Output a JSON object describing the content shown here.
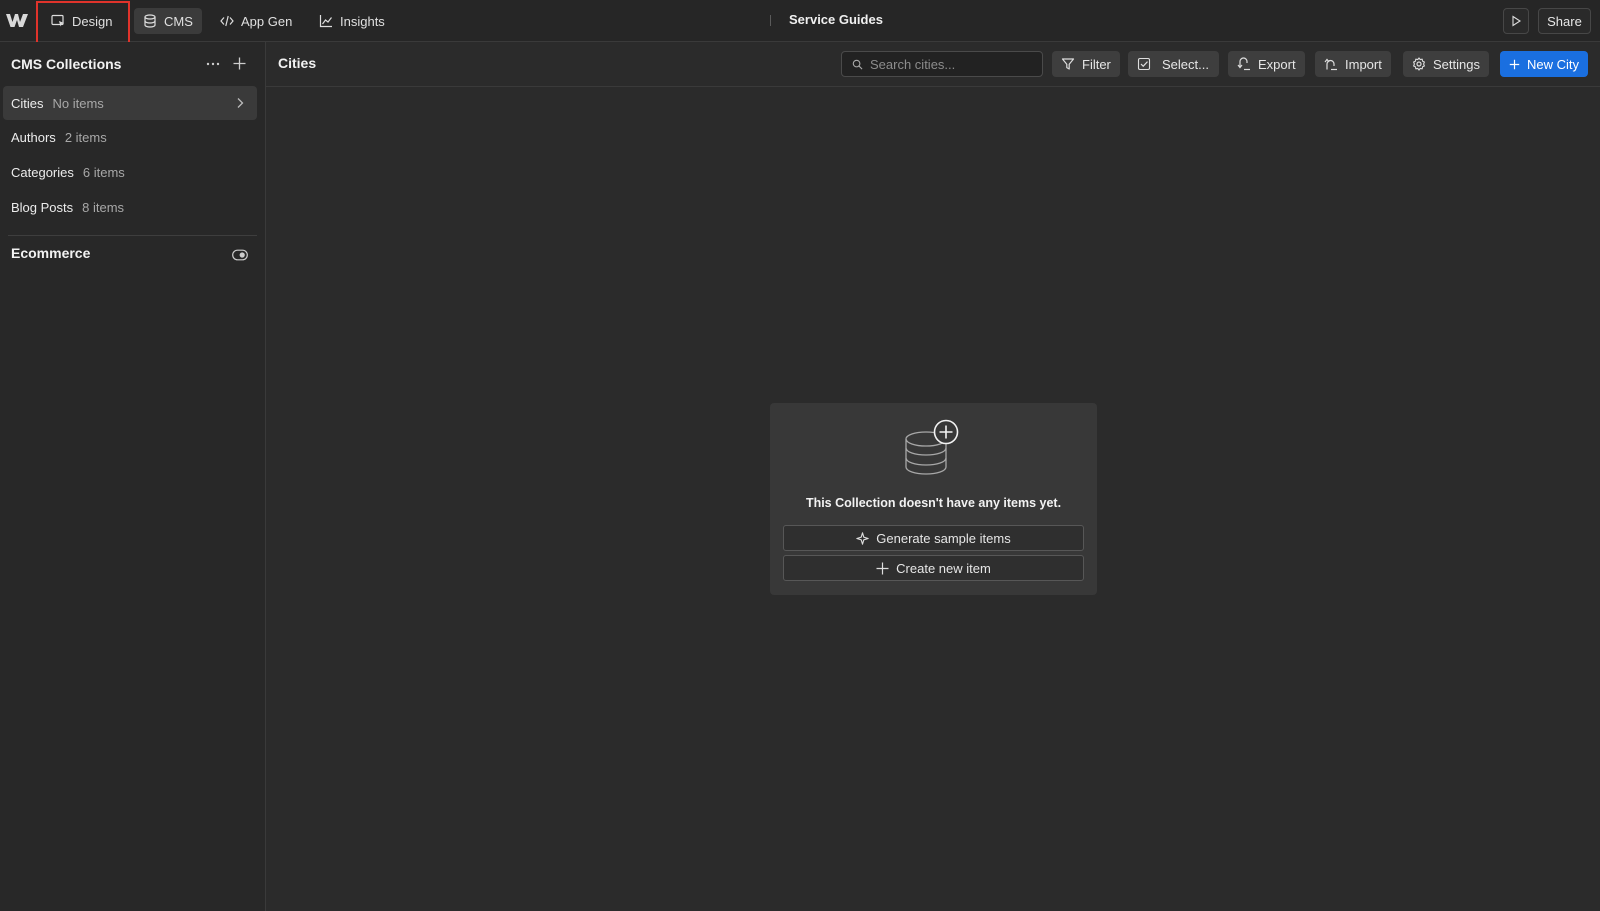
{
  "topbar": {
    "nav": [
      {
        "label": "Design",
        "icon": "design-cursor-icon"
      },
      {
        "label": "CMS",
        "icon": "database-icon"
      },
      {
        "label": "App Gen",
        "icon": "code-icon"
      },
      {
        "label": "Insights",
        "icon": "chart-line-icon"
      }
    ],
    "title": "Service Guides",
    "share_label": "Share"
  },
  "sidebar": {
    "header": "CMS Collections",
    "collections": [
      {
        "name": "Cities",
        "count": "No items"
      },
      {
        "name": "Authors",
        "count": "2 items"
      },
      {
        "name": "Categories",
        "count": "6 items"
      },
      {
        "name": "Blog Posts",
        "count": "8 items"
      }
    ],
    "ecommerce_label": "Ecommerce"
  },
  "main": {
    "title": "Cities",
    "search_placeholder": "Search cities...",
    "toolbar": {
      "filter": "Filter",
      "select": "Select...",
      "export": "Export",
      "import": "Import",
      "settings": "Settings",
      "new_item": "New City"
    },
    "empty_state": {
      "message": "This Collection doesn't have any items yet.",
      "generate_label": "Generate sample items",
      "create_label": "Create new item"
    }
  },
  "colors": {
    "background": "#2b2b2b",
    "primary_button": "#1a6fe0",
    "highlight_box": "#e0332b"
  }
}
